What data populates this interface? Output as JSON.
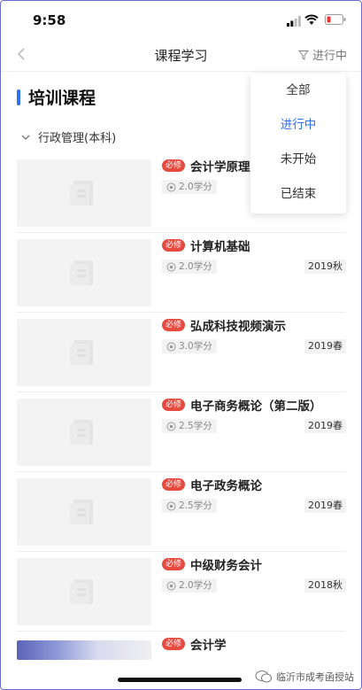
{
  "status_bar": {
    "time": "9:58"
  },
  "nav": {
    "title": "课程学习",
    "filter_label": "进行中"
  },
  "section": {
    "title": "培训课程"
  },
  "group": {
    "title": "行政管理(本科)"
  },
  "courses": [
    {
      "badge": "必修",
      "name": "会计学原理",
      "credit": "2.0学分",
      "term": ""
    },
    {
      "badge": "必修",
      "name": "计算机基础",
      "credit": "2.0学分",
      "term": "2019秋"
    },
    {
      "badge": "必修",
      "name": "弘成科技视频演示",
      "credit": "3.0学分",
      "term": "2019春"
    },
    {
      "badge": "必修",
      "name": "电子商务概论（第二版）",
      "credit": "2.5学分",
      "term": "2019春"
    },
    {
      "badge": "必修",
      "name": "电子政务概论",
      "credit": "2.5学分",
      "term": "2019春"
    },
    {
      "badge": "必修",
      "name": "中级财务会计",
      "credit": "2.0学分",
      "term": "2018秋"
    },
    {
      "badge": "必修",
      "name": "会计学",
      "credit": "",
      "term": ""
    }
  ],
  "dropdown": {
    "options": [
      "全部",
      "进行中",
      "未开始",
      "已结束"
    ],
    "selected": "进行中"
  },
  "watermark": {
    "text": "临沂市成考函授站"
  },
  "colors": {
    "accent": "#2d72f2",
    "badge": "#e64a3f"
  }
}
